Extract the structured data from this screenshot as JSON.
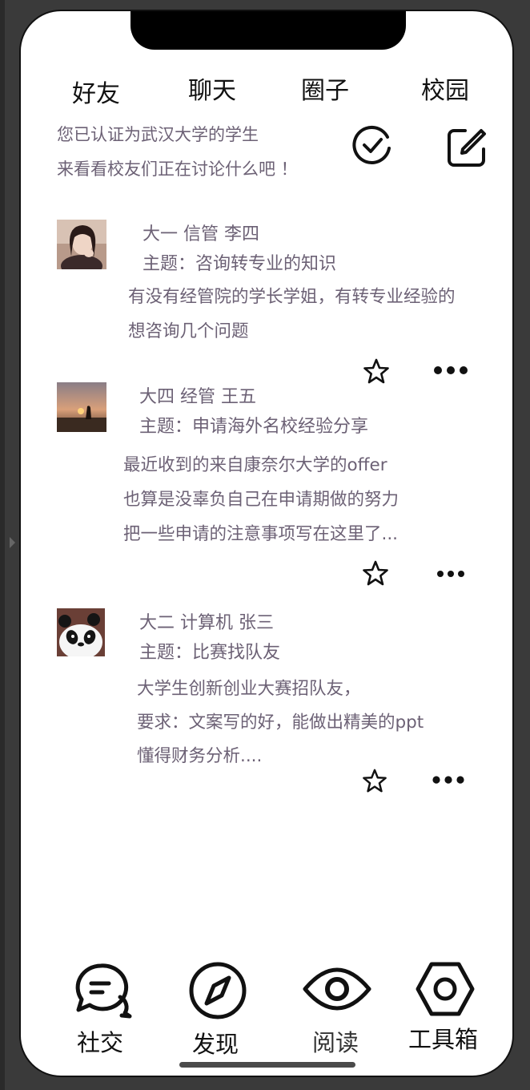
{
  "top_tabs": [
    "好友",
    "聊天",
    "圈子",
    "校园"
  ],
  "verify": {
    "line1": "您已认证为武汉大学的学生",
    "line2": "来看看校友们正在讨论什么吧 ！"
  },
  "icons": {
    "verified": "check-circle-icon",
    "compose": "edit-square-icon",
    "favorite": "star-icon",
    "more": "more-dots-icon"
  },
  "posts": [
    {
      "author": "大一  信管  李四",
      "topic": "主题：咨询转专业的知识",
      "body": [
        "有没有经管院的学长学姐，有转专业经验的",
        "想咨询几个问题"
      ]
    },
    {
      "author": "大四 经管  王五",
      "topic": "主题：申请海外名校经验分享",
      "body": [
        "最近收到的来自康奈尔大学的offer",
        "也算是没辜负自己在申请期做的努力",
        "把一些申请的注意事项写在这里了..."
      ]
    },
    {
      "author": "大二  计算机  张三",
      "topic": "主题：比赛找队友",
      "body": [
        "大学生创新创业大赛招队友，",
        "要求：文案写的好，能做出精美的ppt",
        "懂得财务分析...."
      ]
    }
  ],
  "bottom_nav": [
    {
      "label": "社交",
      "icon": "chat-bubbles-icon"
    },
    {
      "label": "发现",
      "icon": "compass-icon"
    },
    {
      "label": "阅读",
      "icon": "eye-icon"
    },
    {
      "label": "工具箱",
      "icon": "hexagon-nut-icon"
    }
  ],
  "colors": {
    "text_secondary": "#6c6175",
    "text_primary": "#111111",
    "background": "#ffffff"
  }
}
